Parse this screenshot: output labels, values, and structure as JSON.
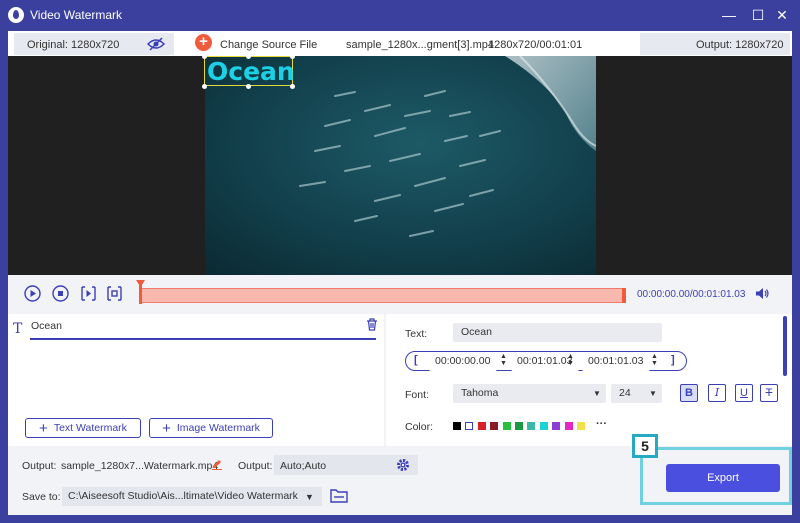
{
  "window": {
    "title": "Video Watermark",
    "controls": {
      "minimize": "—",
      "maximize": "☐",
      "close": "✕"
    }
  },
  "infobar": {
    "original": "Original: 1280x720",
    "change_source": "Change Source File",
    "filename": "sample_1280x...gment[3].mp4",
    "resolution_duration": "1280x720/00:01:01",
    "output": "Output: 1280x720"
  },
  "preview": {
    "watermark_text": "Ocean"
  },
  "timeline": {
    "time": "00:00:00.00/00:01:01.03"
  },
  "watermark_list": {
    "items": [
      {
        "label": "Ocean"
      }
    ],
    "add_text": "Text Watermark",
    "add_image": "Image Watermark"
  },
  "settings": {
    "text_label": "Text:",
    "text_value": "Ocean",
    "start_time": "00:00:00.00",
    "end_time": "00:01:01.03",
    "duration": "00:01:01.03",
    "font_label": "Font:",
    "font_value": "Tahoma",
    "font_size": "24",
    "bold": "B",
    "italic": "I",
    "underline": "U",
    "strike": "T",
    "color_label": "Color:",
    "more_colors": "···",
    "colors": [
      "#000000",
      "#ffffff",
      "#d6202a",
      "#8b1a28",
      "#25c13d",
      "#1a9a44",
      "#3db7a6",
      "#1ad4d4",
      "#8c3dd6",
      "#e526c8",
      "#f0e14a"
    ]
  },
  "bottom": {
    "output_label": "Output:",
    "output_file": "sample_1280x7...Watermark.mp4",
    "output_label2": "Output:",
    "output_format": "Auto;Auto",
    "save_label": "Save to:",
    "save_path": "C:\\Aiseesoft Studio\\Ais...ltimate\\Video Watermark",
    "export": "Export",
    "step": "5"
  },
  "accent": "#3b3fb8"
}
